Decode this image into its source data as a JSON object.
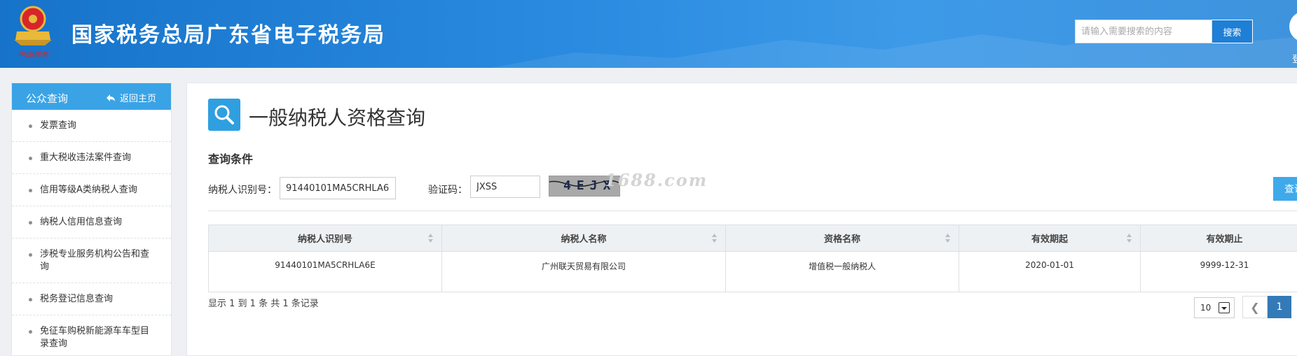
{
  "header": {
    "site_title": "国家税务总局广东省电子税务局",
    "search_placeholder": "请输入需要搜索的内容",
    "search_button": "搜索",
    "user_label": "登",
    "logo_signature": "中国税务"
  },
  "sidebar": {
    "title": "公众查询",
    "back_label": "返回主页",
    "items": [
      {
        "label": "发票查询"
      },
      {
        "label": "重大税收违法案件查询"
      },
      {
        "label": "信用等级A类纳税人查询"
      },
      {
        "label": "纳税人信用信息查询"
      },
      {
        "label": "涉税专业服务机构公告和查询"
      },
      {
        "label": "税务登记信息查询"
      },
      {
        "label": "免征车购税新能源车车型目录查询"
      }
    ]
  },
  "main": {
    "page_title": "一般纳税人资格查询",
    "section_title": "查询条件",
    "taxpayer_id_label": "纳税人识别号：",
    "taxpayer_id_value": "91440101MA5CRHLA6E",
    "captcha_label": "验证码：",
    "captcha_value": "JXSS",
    "captcha_image_text": "4EJX",
    "watermark": "1688.com",
    "query_button": "查询",
    "table": {
      "headers": [
        "纳税人识别号",
        "纳税人名称",
        "资格名称",
        "有效期起",
        "有效期止"
      ],
      "rows": [
        [
          "91440101MA5CRHLA6E",
          "广州联天贸易有限公司",
          "增值税一般纳税人",
          "2020-01-01",
          "9999-12-31"
        ]
      ]
    },
    "record_info": "显示 1 到 1 条 共 1 条记录",
    "page_size": "10",
    "prev_label": "❮",
    "current_page": "1"
  }
}
